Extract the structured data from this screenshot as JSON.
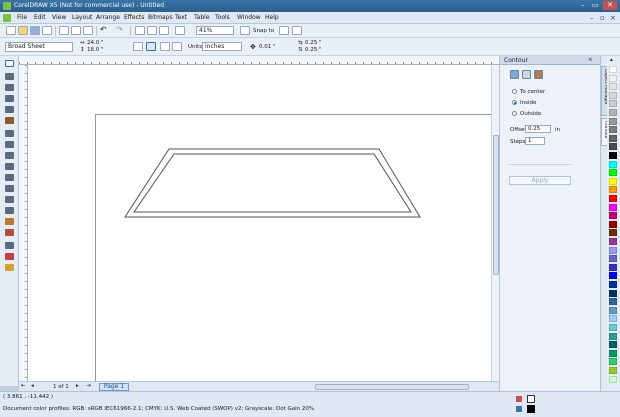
{
  "window": {
    "title": "CorelDRAW X5 (Not for commercial use) - Untitled",
    "minimize": "–",
    "restore": "▭",
    "close": "✕"
  },
  "menu": [
    "File",
    "Edit",
    "View",
    "Layout",
    "Arrange",
    "Effects",
    "Bitmaps",
    "Text",
    "Table",
    "Tools",
    "Window",
    "Help"
  ],
  "standard_toolbar": {
    "zoom_level": "41%",
    "snap_to_label": "Snap to"
  },
  "property_bar": {
    "paper_type": "Broad Sheet",
    "width": "24.0 \"",
    "height": "18.0 \"",
    "units_label": "Units:",
    "units_value": "inches",
    "nudge": "0.01 \"",
    "duplicate_x": "0.25 \"",
    "duplicate_y": "0.25 \""
  },
  "page_nav": {
    "page_count": "1 of 1",
    "page_tab": "Page 1"
  },
  "docker": {
    "title": "Contour",
    "options": [
      "To center",
      "Inside",
      "Outside"
    ],
    "selected_option": "Inside",
    "offset_label": "Offset:",
    "offset_value": "0.25",
    "offset_unit": "in",
    "steps_label": "Steps:",
    "steps_value": "1",
    "apply_label": "Apply",
    "side_tabs": [
      "Object Manager",
      "Contour"
    ]
  },
  "palette_colors": [
    "#ffffff",
    "#f2f2f2",
    "#e5e5e5",
    "#d9d9d9",
    "#cccccc",
    "#b3b3b3",
    "#999999",
    "#808080",
    "#666666",
    "#4d4d4d",
    "#000000",
    "#00ffff",
    "#00ff00",
    "#ffff00",
    "#ff9900",
    "#ff0000",
    "#ff00ff",
    "#cc0066",
    "#990000",
    "#663300",
    "#993399",
    "#9999ff",
    "#6666cc",
    "#3333cc",
    "#0000ff",
    "#003399",
    "#003366",
    "#336699",
    "#6699cc",
    "#99ccff",
    "#66cccc",
    "#339999",
    "#006666",
    "#009966",
    "#33cc66",
    "#99cc33",
    "#ccffcc"
  ],
  "status": {
    "coordinates": "( 3.861 , -11.442 )",
    "color_profile": "Document color profiles: RGB: sRGB IEC61966-2.1; CMYK: U.S. Web Coated (SWOP) v2; Grayscale: Dot Gain 20%"
  },
  "colors": {
    "title_bar": "#2c5e8c",
    "accent": "#1d5fa0"
  }
}
